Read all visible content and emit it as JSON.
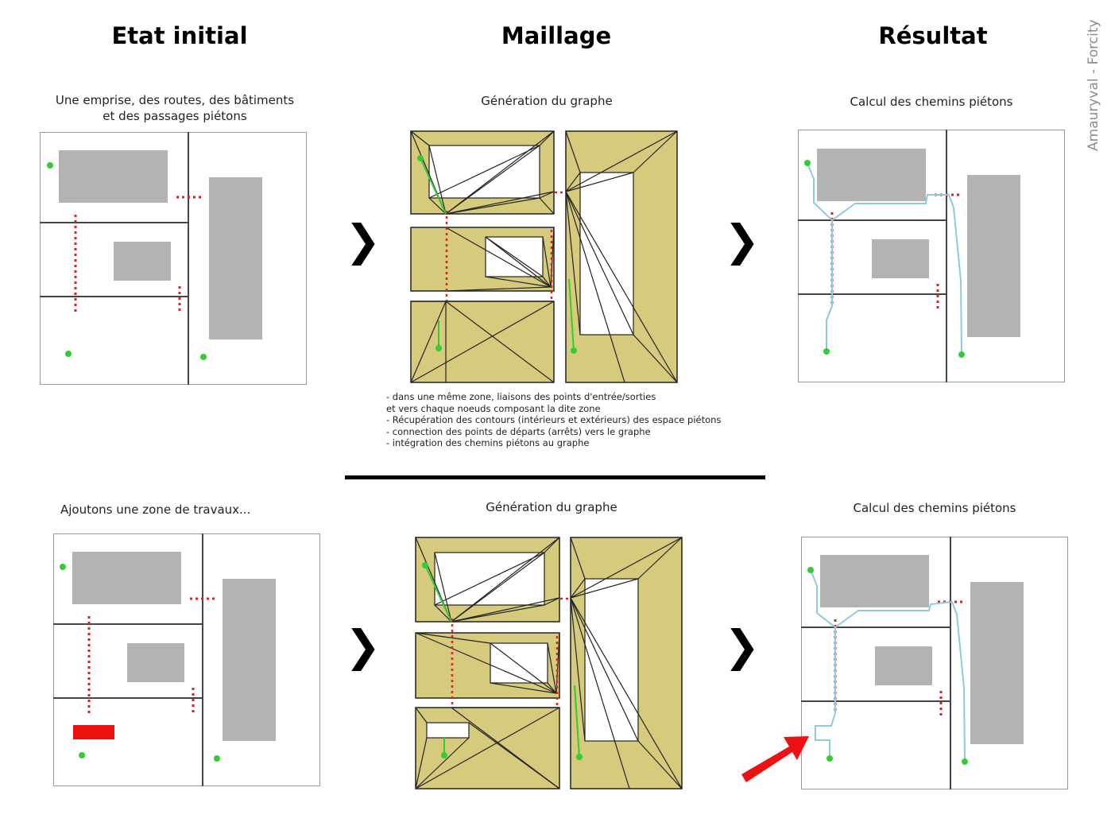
{
  "columns": {
    "initial": "Etat initial",
    "mesh": "Maillage",
    "result": "Résultat"
  },
  "watermark": "Amauryval - Forcity",
  "top": {
    "initial_caption_line1": "Une emprise, des routes, des bâtiments",
    "initial_caption_line2": "et des passages piétons",
    "mesh_caption": "Génération du graphe",
    "result_caption": "Calcul des chemins piétons",
    "notes": [
      "- dans une même zone, liaisons des points d'entrée/sorties",
      "et vers chaque noeuds composant la dite zone",
      "- Récupération des contours (intérieurs et extérieurs) des espace piétons",
      "- connection des points de départs (arrêts) vers le graphe",
      "- intégration des chemins piétons au graphe"
    ]
  },
  "bottom": {
    "initial_caption": "Ajoutons une zone de travaux...",
    "mesh_caption": "Génération du graphe",
    "result_caption": "Calcul des chemins piétons"
  },
  "step_arrow_glyph": "❯",
  "colors": {
    "zone_fill": "#d6cb7d",
    "building": "#b3b3b3",
    "road": "#444444",
    "crossing": "#e02020",
    "start_point": "#33cc33",
    "path": "#8ec9e0",
    "works_zone": "#ee1111",
    "highlight_arrow": "#ee1111"
  }
}
